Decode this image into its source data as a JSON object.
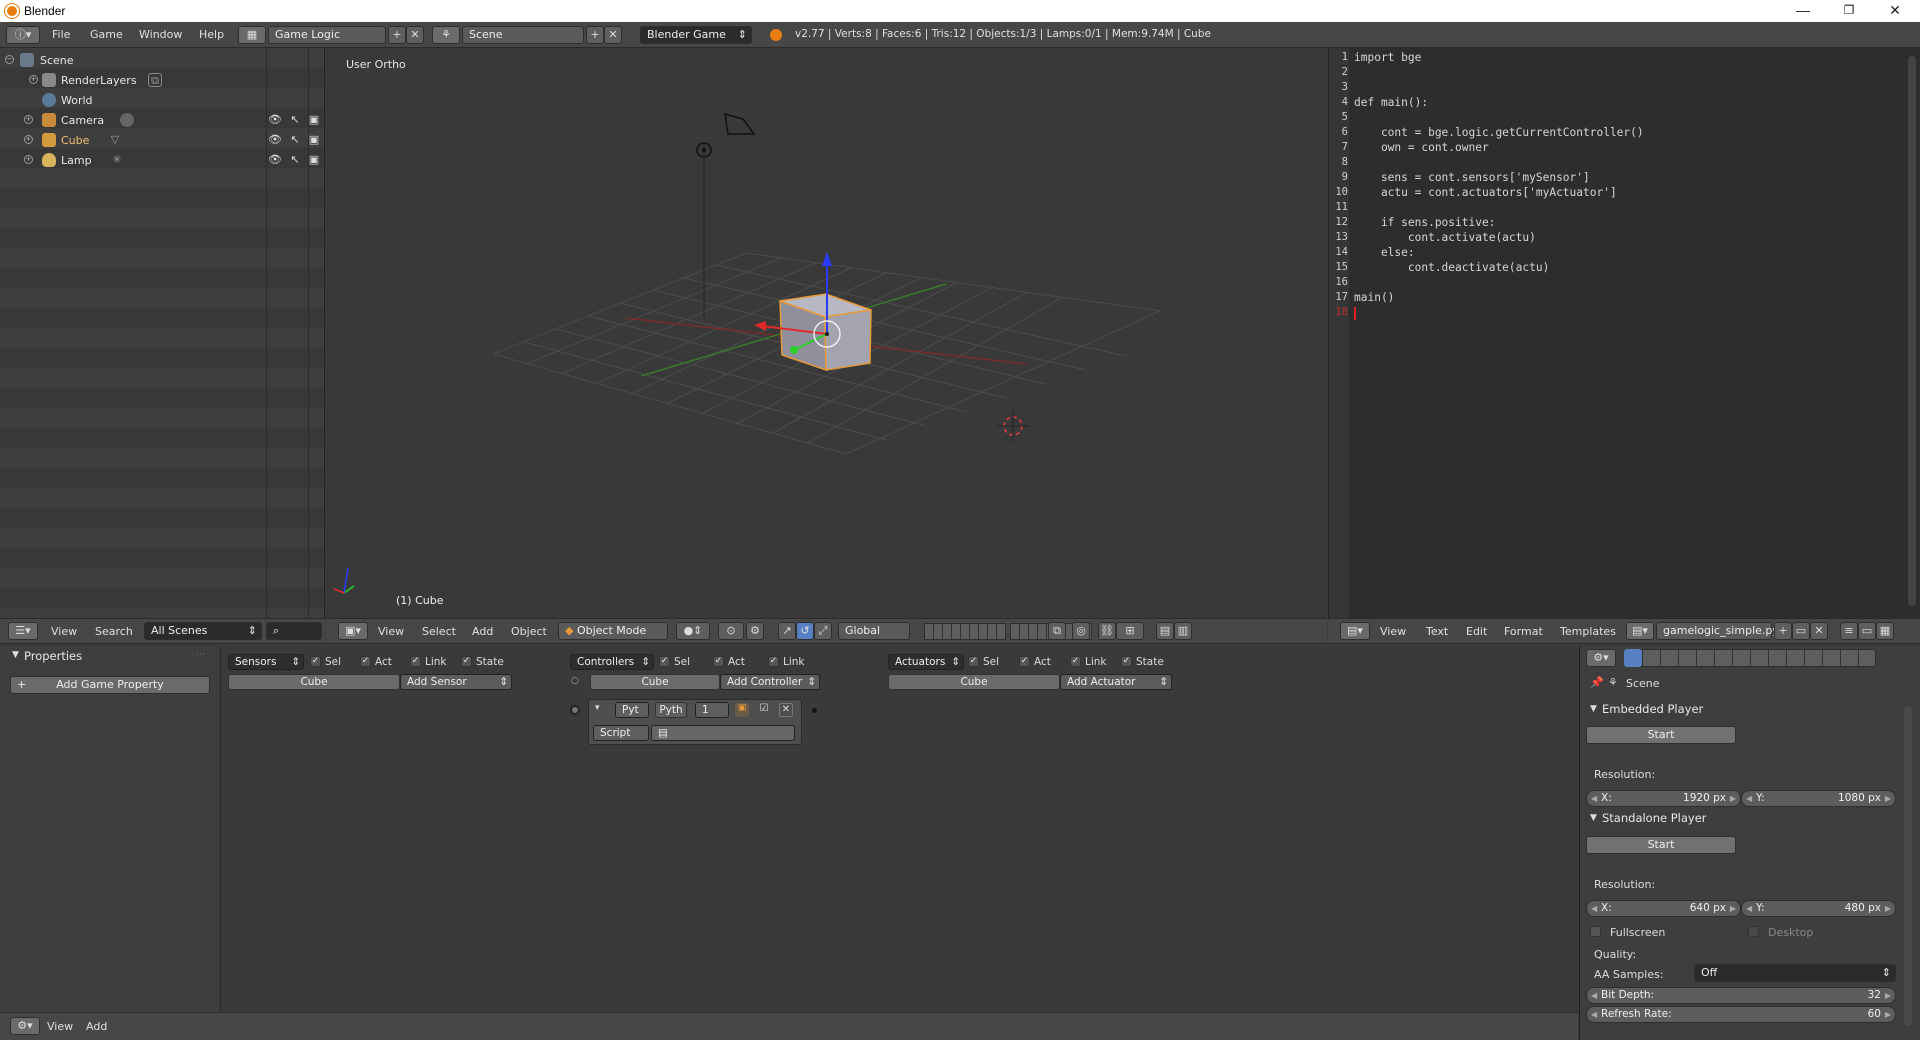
{
  "window": {
    "title": "Blender",
    "minimize": "—",
    "restore": "❐",
    "close": "✕"
  },
  "info": {
    "menus": [
      "File",
      "Game",
      "Window",
      "Help"
    ],
    "screen": "Game Logic",
    "scene": "Scene",
    "engine": "Blender Game",
    "stats": "v2.77 | Verts:8 | Faces:6 | Tris:12 | Objects:1/3 | Lamps:0/1 | Mem:9.74M | Cube"
  },
  "outliner": {
    "items": [
      {
        "label": "Scene"
      },
      {
        "label": "RenderLayers"
      },
      {
        "label": "World"
      },
      {
        "label": "Camera"
      },
      {
        "label": "Cube"
      },
      {
        "label": "Lamp"
      }
    ]
  },
  "view3d": {
    "view_name": "User Ortho",
    "object_info": "(1) Cube",
    "menus": [
      "View",
      "Select",
      "Add",
      "Object"
    ],
    "mode": "Object Mode",
    "orientation": "Global"
  },
  "outliner_header": {
    "menus": [
      "View",
      "Search"
    ],
    "filter": "All Scenes"
  },
  "text_editor": {
    "lines": [
      "import bge",
      "",
      "",
      "def main():",
      "",
      "    cont = bge.logic.getCurrentController()",
      "    own = cont.owner",
      "",
      "    sens = cont.sensors['mySensor']",
      "    actu = cont.actuators['myActuator']",
      "",
      "    if sens.positive:",
      "        cont.activate(actu)",
      "    else:",
      "        cont.deactivate(actu)",
      "",
      "main()",
      ""
    ],
    "line_numbers": [
      "1",
      "2",
      "3",
      "4",
      "5",
      "6",
      "7",
      "8",
      "9",
      "10",
      "11",
      "12",
      "13",
      "14",
      "15",
      "16",
      "17",
      "18"
    ],
    "menus": [
      "View",
      "Text",
      "Edit",
      "Format",
      "Templates"
    ],
    "filename": "gamelogic_simple.py"
  },
  "logic": {
    "properties_title": "Properties",
    "add_property": "Add Game Property",
    "sensors": {
      "label": "Sensors",
      "object": "Cube",
      "add": "Add Sensor"
    },
    "controllers": {
      "label": "Controllers",
      "object": "Cube",
      "add": "Add Controller"
    },
    "actuators": {
      "label": "Actuators",
      "object": "Cube",
      "add": "Add Actuator"
    },
    "checks": {
      "sel": "Sel",
      "act": "Act",
      "link": "Link",
      "state": "State"
    },
    "controller_block": {
      "type": "Pyt",
      "name": "Pyth",
      "state": "1",
      "script_label": "Script"
    }
  },
  "bottom": {
    "menus": [
      "View",
      "Add"
    ]
  },
  "props_panel": {
    "context": "Scene",
    "embedded": {
      "title": "Embedded Player",
      "start": "Start",
      "resolution": "Resolution:",
      "x": "1920 px",
      "y": "1080 px"
    },
    "standalone": {
      "title": "Standalone Player",
      "start": "Start",
      "resolution": "Resolution:",
      "x": "640 px",
      "y": "480 px"
    },
    "fullscreen": "Fullscreen",
    "desktop": "Desktop",
    "quality": "Quality:",
    "aa_label": "AA Samples:",
    "aa_value": "Off",
    "bit_depth_label": "Bit Depth:",
    "bit_depth": "32",
    "refresh_label": "Refresh Rate:",
    "refresh": "60",
    "x_key": "X:",
    "y_key": "Y:"
  }
}
